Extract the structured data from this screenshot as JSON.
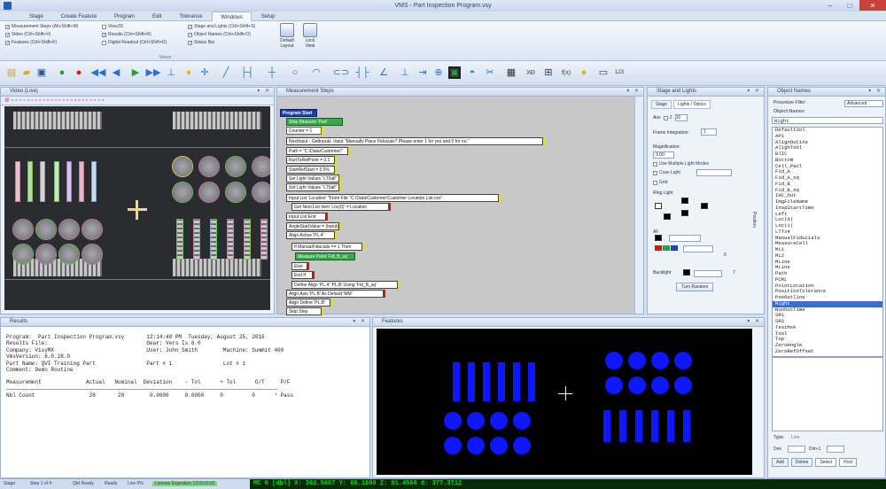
{
  "window": {
    "title": "VMS - Part Inspection Program.vsy"
  },
  "tabs": [
    "Stage",
    "Create Feature",
    "Program",
    "Edit",
    "Tolerance",
    "Windows",
    "Setup"
  ],
  "ribbon": {
    "col1": [
      "Measurement Steps (Alt+Shift+M)",
      "Video (Ctrl+Shift+V)",
      "Features (Ctrl+Shift+F)"
    ],
    "col2": [
      "View3D",
      "Results (Ctrl+Shift+R)",
      "Digital Readout (Ctrl+Shift+D)"
    ],
    "col3": [
      "Stage and Lights (Ctrl+Shift+S)",
      "Object Names (Ctrl+Shift+O)",
      "Status Bar"
    ],
    "btn1": "Default Layout",
    "btn2": "Lock View",
    "group": "Views"
  },
  "panels": {
    "video": "Video (Live)",
    "steps": "Measurement Steps",
    "stage": "Stage and Lights",
    "objects": "Object Names",
    "results": "Results",
    "features": "Features"
  },
  "steps": [
    "Program Start",
    "Stop Measure 'Part'",
    "Counter = 1",
    "NextInput - GetInputs, Input \"Manually Place Fiducials? Please enter 1 for yes and 0 for no.\"",
    "Path = \"C:\\Data\\Customer\\\"",
    "RunToRefPoint = 0.1",
    "StartRefStart = 0.5%",
    "Set Light Values \"LT0all\"",
    "Set Light Values \"LT0all\"",
    "Input List 'Location' \"From File \"C:\\Data\\Customer\\Customer Location List.csv\"",
    "Get Next List Item 'Loc(0)' = Location",
    "Input List End",
    "AngleStartValue = (Input)",
    "Align Active 'PL.4'",
    "If ManualFiducials == 1 Then",
    "Measure Point 'Fid_B_sq'",
    "Else",
    "End If",
    "Define Align 'PL.4' 'PL.B' Using 'Fid_B_sq'",
    "Align Axis 'PL.B' As Default 'MM'",
    "Align Define 'PL.B'",
    "Skip Step"
  ],
  "stage": {
    "tabs": [
      "Stage",
      "Lights / Optics"
    ],
    "z_label": "Z",
    "frame_label": "Frame Integration:",
    "frame_value": "1",
    "mag_label": "Magnification:",
    "mag_value": "3.00",
    "use_lights_label": "Use Multiple Light Modes",
    "coax_label": "Coax Light",
    "grid_label": "Grid",
    "ring_label": "Ring Light",
    "all_label": "All",
    "backlight_label": "Backlight",
    "value_a": "10",
    "value_b": "0",
    "value_c": "7",
    "auto_btn": "Turn Random",
    "ring_side": "Position"
  },
  "objects": {
    "procedure_label": "Procedure Filter:",
    "dropdown": "Advanced",
    "header": "Object Names",
    "search": "Right",
    "items": [
      "Default3ol",
      "AP1",
      "AlignOut1ne",
      "AlignTool",
      "BlIC",
      "Bottom",
      "Cell_Pacl",
      "Fid_A",
      "Fid_A_sq",
      "Fid_B",
      "Fid_B_sq",
      "IHC_Out",
      "ImgFileName",
      "InspStartTime",
      "Left",
      "Loc(0)",
      "Loc(1)",
      "LTTx4",
      "ManualFiducials",
      "MeasureCell",
      "ML1",
      "ML2",
      "MLine",
      "MLine",
      "Path",
      "PCRL",
      "PointLocation",
      "PositionTolerance",
      "PosOutline",
      "Right",
      "RunOutTime",
      "SR1",
      "SR2",
      "TestMsk",
      "Tool",
      "Top",
      "ZeroAngle",
      "ZeroRefOffset"
    ],
    "selected": "Right",
    "type_label": "Type:",
    "type_value": "Line",
    "btn_dash": "Des",
    "btn_dim": "Dim-1",
    "btn_add": "Add",
    "btn_delete": "Delete",
    "btn_select": "Select",
    "btn_find": "Find"
  },
  "results": {
    "lines": [
      "Program:  Part Inspection Program.vsy       12:14:40 PM  Tuesday, August 25, 2016",
      "Results File:                               Gear: Vers Is 6.0",
      "Company: VisyMX                             User: John Smith        Machine: Summit 400",
      "VmsVersion: 6.0.28.0",
      "Part Name: QVI Training Part                Part # 1                Lot # 1",
      "Comment: Demo Routine",
      "",
      "Measurement              Actual   Nominal  Deviation    - Tol      + Tol      O/T     P/F",
      "─────────────────────────────────────────────────────────────────────────────────────",
      "Nbl Count                 28       28        0.0000     0.0000     0         0      * Pass"
    ]
  },
  "status": {
    "items": [
      "Stage",
      "Step 1 of 4",
      "Qtd Ready",
      "Ready",
      "Live 0%",
      "License Expiration 12/31/2016"
    ],
    "coords": "MC 0 [dbl] X: 362.5667  Y: 66.1600  Z: 81.4566  d: 377.3712"
  },
  "colors": {
    "accent": "#3b6ccf",
    "feature_blue": "#0f17ff",
    "features_bg": "#000000",
    "status_bg": "#072a07",
    "status_text": "#00e000"
  }
}
